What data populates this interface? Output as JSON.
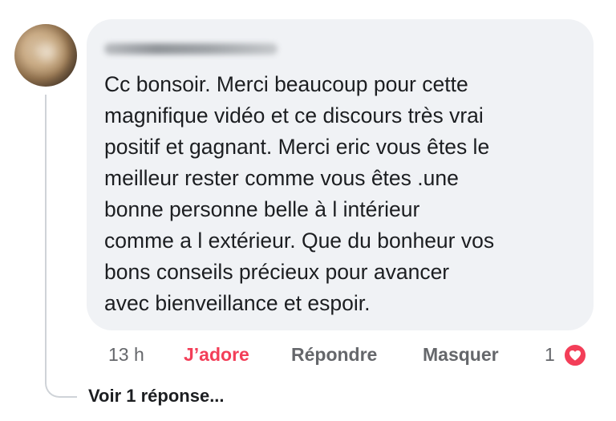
{
  "comment": {
    "text": "Cc bonsoir. Merci beaucoup pour cette\nmagnifique vidéo et ce discours très vrai\npositif et gagnant. Merci eric vous êtes le\nmeilleur rester comme vous êtes  .une\nbonne personne belle à l intérieur\ncomme a l extérieur. Que du bonheur vos\nbons conseils précieux pour avancer\navec bienveillance et espoir."
  },
  "actions": {
    "timestamp": "13 h",
    "react_label": "J’adore",
    "reply_label": "Répondre",
    "hide_label": "Masquer",
    "reaction_count": "1",
    "reaction_type": "heart-icon"
  },
  "replies": {
    "view_label": "Voir 1 réponse..."
  },
  "colors": {
    "bubble_bg": "#f0f2f5",
    "text": "#1c1e21",
    "secondary": "#65676b",
    "love_red": "#f33e58"
  }
}
